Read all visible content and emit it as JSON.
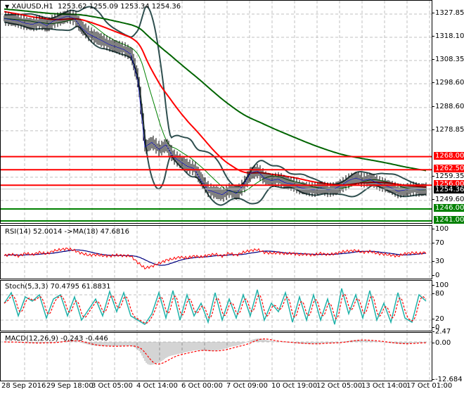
{
  "header": {
    "symbol": "XAUUSD,H1",
    "open": "1253.62",
    "high": "1255.09",
    "low": "1253.34",
    "close": "1254.36"
  },
  "price_axis": {
    "ticks": [
      "1327.85",
      "1318.10",
      "1308.35",
      "1298.60",
      "1288.60",
      "1278.85",
      "1259.35",
      "1249.60"
    ],
    "levels": [
      {
        "label": "1268.00",
        "price": 1268.0,
        "color": "#ff0000"
      },
      {
        "label": "1262.50",
        "price": 1262.5,
        "color": "#ff0000"
      },
      {
        "label": "1256.00",
        "price": 1256.0,
        "color": "#ff0000"
      },
      {
        "label": "1246.00",
        "price": 1246.0,
        "color": "#008000"
      },
      {
        "label": "1241.00",
        "price": 1241.0,
        "color": "#008000"
      }
    ],
    "current": {
      "label": "1254.36",
      "price": 1254.36,
      "color": "#000000"
    }
  },
  "rsi": {
    "title": "RSI(14) 52.0014  ->MA(18) 47.6816",
    "ticks": [
      "100",
      "70",
      "30",
      "0"
    ]
  },
  "stoch": {
    "title": "Stoch(5,3,3) 70.4795 61.8831",
    "ticks": [
      "100",
      "80",
      "20",
      "0"
    ]
  },
  "macd": {
    "title": "MACD(12,26,9) -0.243 -0.446",
    "ticks": [
      "2.47",
      "0.00",
      "-12.684"
    ]
  },
  "time_axis": [
    "28 Sep 2016",
    "29 Sep 18:00",
    "3 Oct 05:00",
    "4 Oct 14:00",
    "6 Oct 00:00",
    "7 Oct 09:00",
    "10 Oct 19:00",
    "12 Oct 05:00",
    "13 Oct 14:00",
    "17 Oct 01:00"
  ],
  "chart_data": {
    "type": "line",
    "title": "XAUUSD,H1",
    "ylim": [
      1238,
      1332
    ],
    "grid": true,
    "close": [
      1326,
      1325.5,
      1325,
      1324,
      1323.5,
      1324.5,
      1323,
      1325,
      1326,
      1327,
      1326,
      1322,
      1319.5,
      1318,
      1316.5,
      1315,
      1314,
      1313,
      1311,
      1300,
      1272,
      1274,
      1271,
      1273,
      1268,
      1266,
      1264,
      1263,
      1258,
      1254,
      1253,
      1252,
      1254,
      1252.5,
      1256,
      1261,
      1262,
      1259,
      1258,
      1258.5,
      1257,
      1256.5,
      1255,
      1254.5,
      1254,
      1255,
      1254,
      1254.5,
      1256,
      1258,
      1259,
      1258,
      1258.5,
      1257,
      1256,
      1255,
      1253.5,
      1254,
      1254.5,
      1254,
      1254.36
    ],
    "colors": {
      "ma_fast": "#ff0000",
      "ma_slow": "#006400",
      "bands": "#2f4f4f",
      "rsi": "#ff0000",
      "rsi_ma": "#000080",
      "stoch_main": "#20b2aa",
      "stoch_signal": "#ff0000",
      "macd_hist": "#a9a9a9",
      "macd_signal": "#ff0000"
    },
    "rsi_values": [
      45,
      48,
      44,
      50,
      47,
      52,
      49,
      55,
      58,
      60,
      56,
      50,
      46,
      47,
      45,
      44,
      46,
      45,
      44,
      30,
      18,
      22,
      28,
      35,
      38,
      42,
      40,
      44,
      42,
      46,
      48,
      44,
      50,
      46,
      52,
      56,
      58,
      52,
      50,
      51,
      49,
      50,
      47,
      48,
      46,
      50,
      47,
      49,
      53,
      55,
      56,
      52,
      54,
      50,
      48,
      46,
      44,
      49,
      51,
      50,
      52
    ],
    "stoch_values": [
      60,
      85,
      30,
      75,
      65,
      80,
      25,
      70,
      80,
      30,
      75,
      20,
      45,
      70,
      30,
      88,
      40,
      85,
      30,
      20,
      10,
      35,
      85,
      25,
      90,
      20,
      80,
      30,
      60,
      15,
      85,
      20,
      70,
      25,
      80,
      30,
      92,
      20,
      60,
      40,
      85,
      15,
      75,
      20,
      80,
      20,
      70,
      10,
      95,
      35,
      80,
      25,
      90,
      20,
      60,
      15,
      85,
      25,
      15,
      80,
      65
    ]
  }
}
